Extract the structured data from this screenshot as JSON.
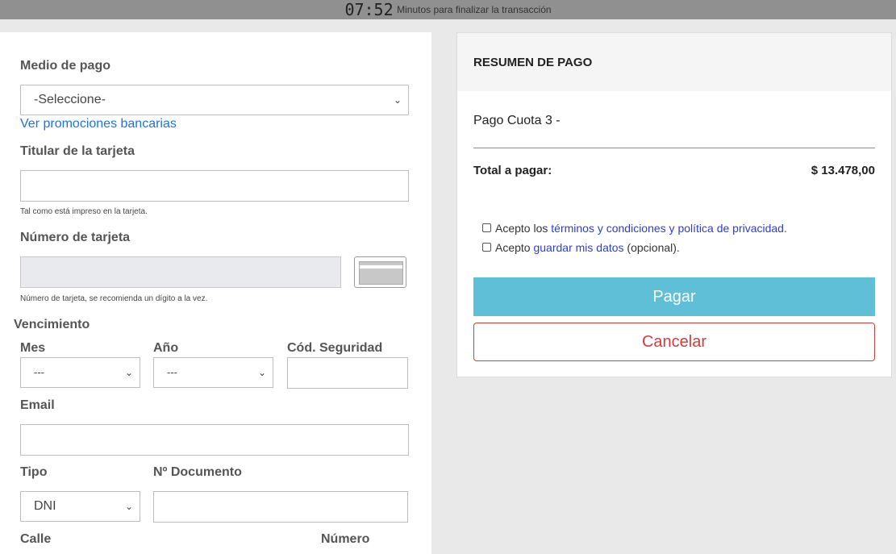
{
  "timer": {
    "time": "07:52",
    "label": "Minutos para finalizar la transacción"
  },
  "form": {
    "payment_method": {
      "label": "Medio de pago",
      "value": "-Seleccione-"
    },
    "promotions_link": "Ver promociones bancarias",
    "card_holder": {
      "label": "Titular de la tarjeta",
      "value": "",
      "help": "Tal como está impreso en la tarjeta."
    },
    "card_number": {
      "label": "Número de tarjeta",
      "value": "",
      "help": "Número de tarjeta, se recomienda un dígito a la vez."
    },
    "expiry": {
      "label": "Vencimiento",
      "month": {
        "label": "Mes",
        "value": "---"
      },
      "year": {
        "label": "Año",
        "value": "---"
      },
      "cvv": {
        "label": "Cód. Seguridad",
        "value": ""
      }
    },
    "email": {
      "label": "Email",
      "value": ""
    },
    "doc_type": {
      "label": "Tipo",
      "value": "DNI"
    },
    "doc_number": {
      "label": "Nº Documento",
      "value": ""
    },
    "street": {
      "label": "Calle"
    },
    "number": {
      "label": "Número"
    }
  },
  "summary": {
    "title": "RESUMEN DE PAGO",
    "item": "Pago Cuota 3 -",
    "total_label": "Total a pagar:",
    "total_value": "$ 13.478,00",
    "terms": {
      "prefix": "Acepto los ",
      "link": "términos y condiciones y política de privacidad.",
      "checked": false
    },
    "save_data": {
      "prefix": "Acepto ",
      "link": "guardar mis datos",
      "suffix": " (opcional).",
      "checked": false
    },
    "pay_button": "Pagar",
    "cancel_button": "Cancelar"
  },
  "icons": {
    "chevron": "chevron-down-icon",
    "card": "credit-card-icon"
  },
  "colors": {
    "pay": "#5fbfd7",
    "cancel": "#d63b3b",
    "link": "#1a73e8",
    "divider": "#5b9bd5"
  }
}
